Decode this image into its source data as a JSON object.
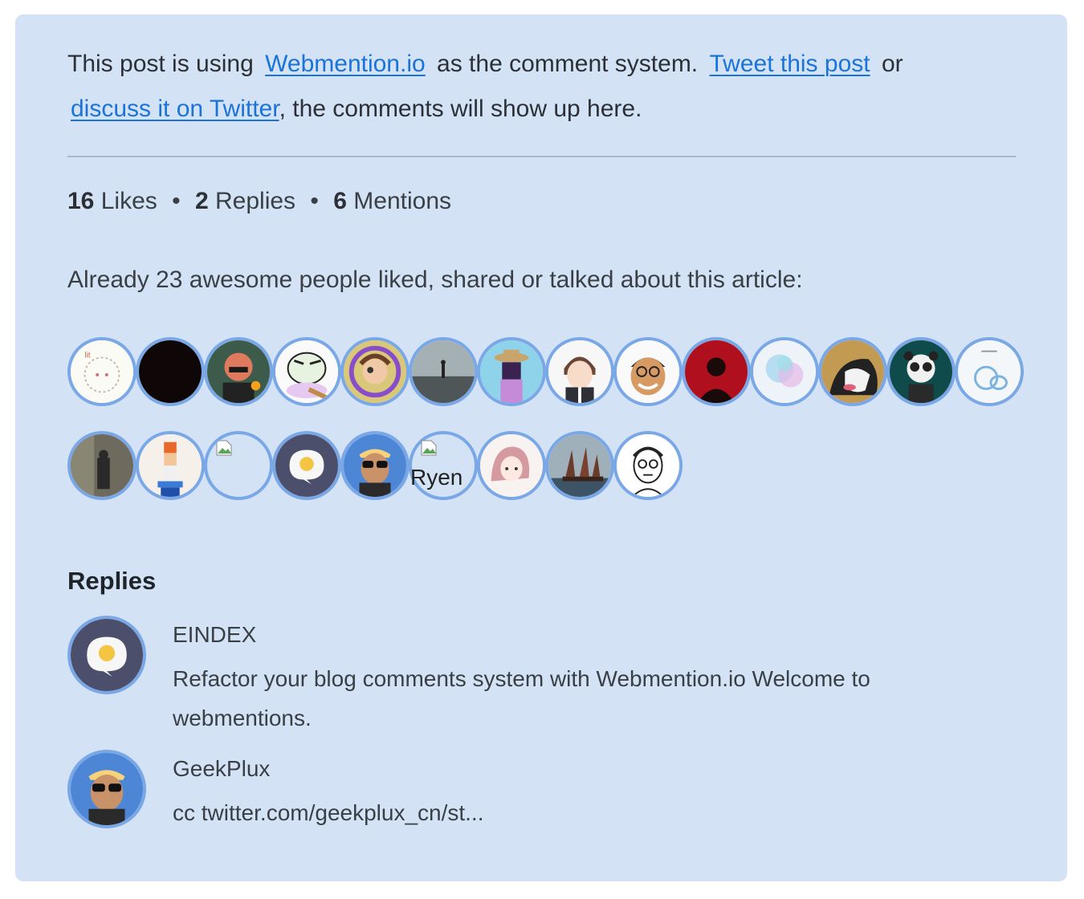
{
  "intro": {
    "lead": "This post is using",
    "webmention_link": "Webmention.io",
    "mid": "as the comment system.",
    "tweet_link": "Tweet this post",
    "or": "or",
    "discuss_link": "discuss it on Twitter",
    "tail": ", the comments will show up here."
  },
  "stats": {
    "likes_count": "16",
    "likes_label": "Likes",
    "replies_count": "2",
    "replies_label": "Replies",
    "mentions_count": "6",
    "mentions_label": "Mentions",
    "separator": "•"
  },
  "already_text": "Already 23 awesome people liked, shared or talked about this article:",
  "facepile": {
    "fallback_name": "Ryen",
    "accent": "#7aa7e6"
  },
  "replies": {
    "title": "Replies",
    "items": [
      {
        "author": "EINDEX",
        "content": "Refactor your blog comments system with Webmention.io Welcome to webmentions."
      },
      {
        "author": "GeekPlux",
        "content": "cc twitter.com/geekplux_cn/st..."
      }
    ]
  },
  "colors": {
    "card_bg": "#d3e3f5",
    "link": "#1a73d9",
    "ring": "#7aa7e6"
  }
}
